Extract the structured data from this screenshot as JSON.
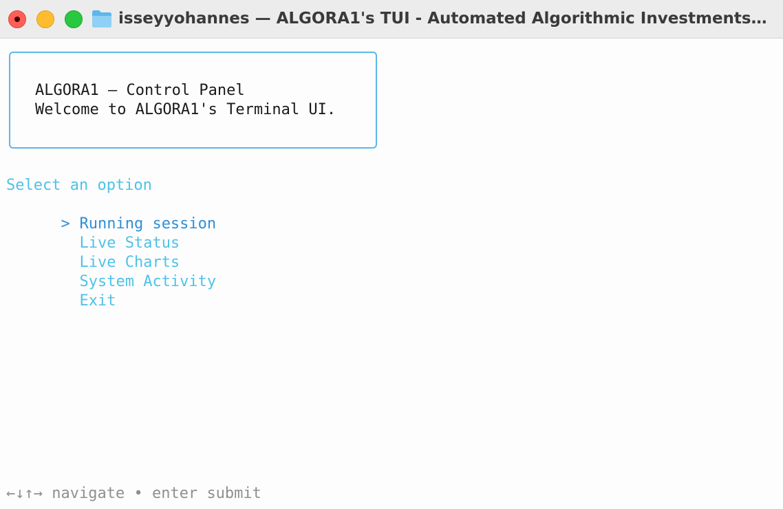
{
  "window": {
    "title": "isseyyohannes — ALGORA1's TUI - Automated Algorithmic Investments -..."
  },
  "panel": {
    "title": "ALGORA1 — Control Panel",
    "welcome": "Welcome to ALGORA1's Terminal UI."
  },
  "menu": {
    "prompt": "Select an option",
    "cursor": ">",
    "items": [
      {
        "label": "Running session",
        "selected": true
      },
      {
        "label": "Live Status",
        "selected": false
      },
      {
        "label": "Live Charts",
        "selected": false
      },
      {
        "label": "System Activity",
        "selected": false
      },
      {
        "label": "Exit",
        "selected": false
      }
    ]
  },
  "footer": {
    "keys": "←↓↑→",
    "navigate": "navigate",
    "separator": "•",
    "enter": "enter",
    "submit": "submit"
  },
  "colors": {
    "accent": "#4fc1e9",
    "selected": "#2f8fd8",
    "border": "#5ab8e8",
    "hint": "#8f8f8f"
  }
}
